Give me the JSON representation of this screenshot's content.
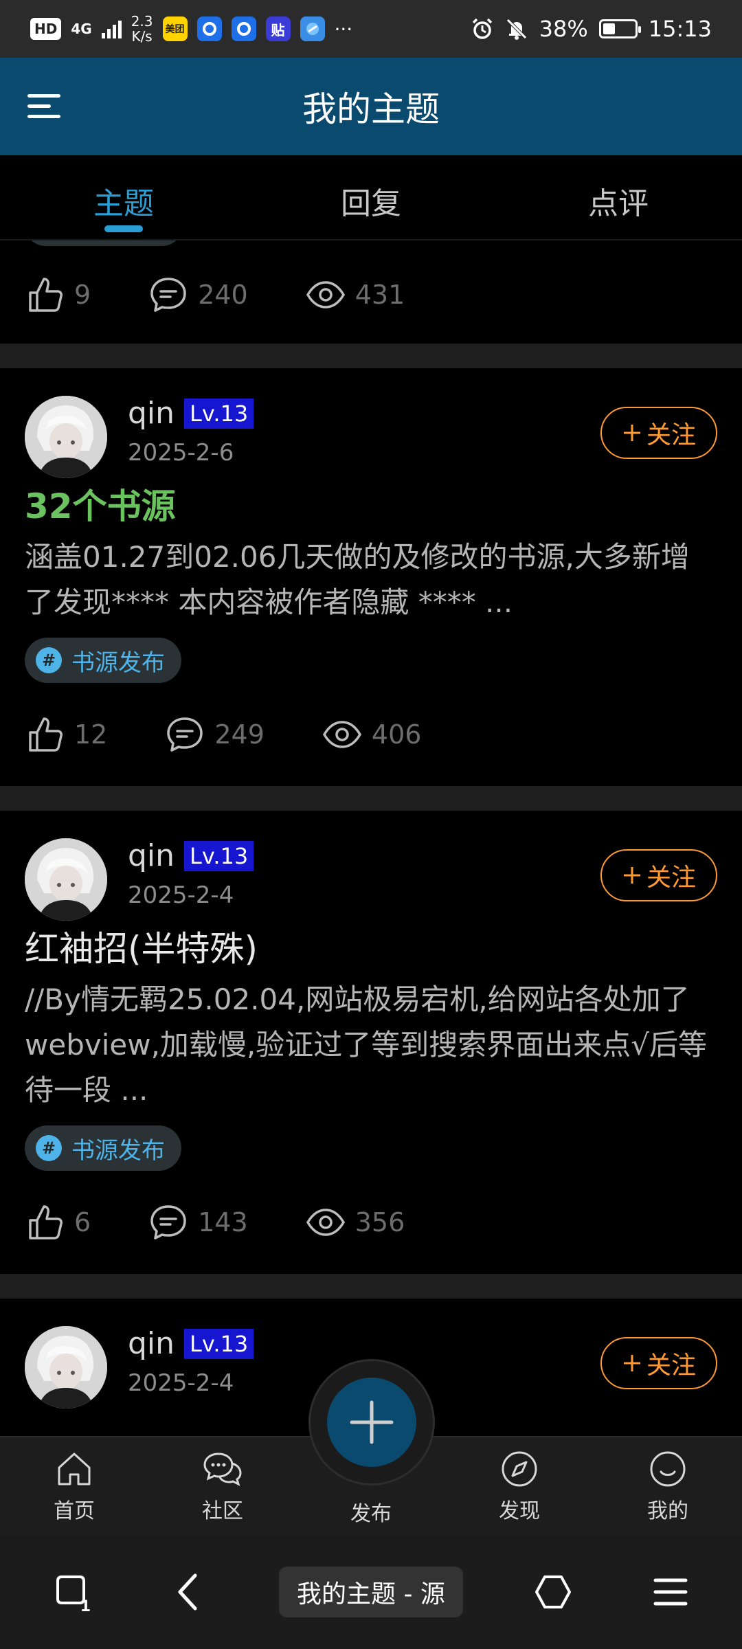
{
  "status_bar": {
    "hd_badge": "HD",
    "network": "4G",
    "speed_value": "2.3",
    "speed_unit": "K/s",
    "app_icons": [
      "美团",
      "",
      "",
      "贴",
      ""
    ],
    "more": "···",
    "battery": "38%",
    "battery_level": 0.38,
    "time": "15:13"
  },
  "header": {
    "title": "我的主题"
  },
  "tabs": [
    {
      "label": "主题",
      "active": true
    },
    {
      "label": "回复",
      "active": false
    },
    {
      "label": "点评",
      "active": false
    }
  ],
  "partial_post": {
    "likes": "9",
    "comments": "240",
    "views": "431"
  },
  "posts": [
    {
      "author": "qin",
      "level": "Lv.13",
      "date": "2025-2-6",
      "follow_label": "关注",
      "title": "32个书源",
      "excerpt": "涵盖01.27到02.06几天做的及修改的书源,大多新增了发现**** 本内容被作者隐藏 **** ...",
      "tag": "书源发布",
      "likes": "12",
      "comments": "249",
      "views": "406"
    },
    {
      "author": "qin",
      "level": "Lv.13",
      "date": "2025-2-4",
      "follow_label": "关注",
      "title": "红袖招(半特殊)",
      "excerpt": "//By情无羁25.02.04,网站极易宕机,给网站各处加了webview,加载慢,验证过了等到搜索界面出来点√后等待一段 ...",
      "tag": "书源发布",
      "likes": "6",
      "comments": "143",
      "views": "356"
    },
    {
      "author": "qin",
      "level": "Lv.13",
      "date": "2025-2-4",
      "follow_label": "关注"
    }
  ],
  "bottom_nav": [
    {
      "label": "首页",
      "icon": "home-icon"
    },
    {
      "label": "社区",
      "icon": "community-icon"
    },
    {
      "label": "发布",
      "icon": "plus-icon"
    },
    {
      "label": "发现",
      "icon": "compass-icon"
    },
    {
      "label": "我的",
      "icon": "smile-icon"
    }
  ],
  "system_bar": {
    "tab_count": "1",
    "page_title": "我的主题 - 源"
  },
  "colors": {
    "header_bg": "#0b4a6f",
    "accent_blue": "#2a9fd6",
    "follow_orange": "#ff9a33",
    "title_green": "#6ac35e",
    "level_badge": "#1616d0"
  }
}
